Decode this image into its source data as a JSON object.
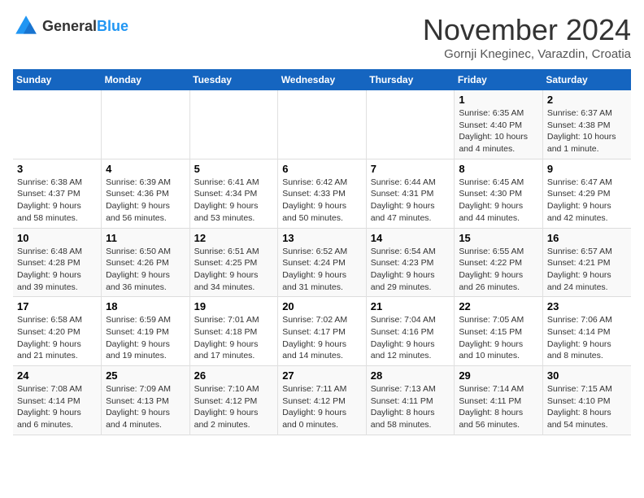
{
  "header": {
    "logo_general": "General",
    "logo_blue": "Blue",
    "month_year": "November 2024",
    "location": "Gornji Kneginec, Varazdin, Croatia"
  },
  "days_of_week": [
    "Sunday",
    "Monday",
    "Tuesday",
    "Wednesday",
    "Thursday",
    "Friday",
    "Saturday"
  ],
  "weeks": [
    [
      {
        "day": "",
        "info": ""
      },
      {
        "day": "",
        "info": ""
      },
      {
        "day": "",
        "info": ""
      },
      {
        "day": "",
        "info": ""
      },
      {
        "day": "",
        "info": ""
      },
      {
        "day": "1",
        "info": "Sunrise: 6:35 AM\nSunset: 4:40 PM\nDaylight: 10 hours and 4 minutes."
      },
      {
        "day": "2",
        "info": "Sunrise: 6:37 AM\nSunset: 4:38 PM\nDaylight: 10 hours and 1 minute."
      }
    ],
    [
      {
        "day": "3",
        "info": "Sunrise: 6:38 AM\nSunset: 4:37 PM\nDaylight: 9 hours and 58 minutes."
      },
      {
        "day": "4",
        "info": "Sunrise: 6:39 AM\nSunset: 4:36 PM\nDaylight: 9 hours and 56 minutes."
      },
      {
        "day": "5",
        "info": "Sunrise: 6:41 AM\nSunset: 4:34 PM\nDaylight: 9 hours and 53 minutes."
      },
      {
        "day": "6",
        "info": "Sunrise: 6:42 AM\nSunset: 4:33 PM\nDaylight: 9 hours and 50 minutes."
      },
      {
        "day": "7",
        "info": "Sunrise: 6:44 AM\nSunset: 4:31 PM\nDaylight: 9 hours and 47 minutes."
      },
      {
        "day": "8",
        "info": "Sunrise: 6:45 AM\nSunset: 4:30 PM\nDaylight: 9 hours and 44 minutes."
      },
      {
        "day": "9",
        "info": "Sunrise: 6:47 AM\nSunset: 4:29 PM\nDaylight: 9 hours and 42 minutes."
      }
    ],
    [
      {
        "day": "10",
        "info": "Sunrise: 6:48 AM\nSunset: 4:28 PM\nDaylight: 9 hours and 39 minutes."
      },
      {
        "day": "11",
        "info": "Sunrise: 6:50 AM\nSunset: 4:26 PM\nDaylight: 9 hours and 36 minutes."
      },
      {
        "day": "12",
        "info": "Sunrise: 6:51 AM\nSunset: 4:25 PM\nDaylight: 9 hours and 34 minutes."
      },
      {
        "day": "13",
        "info": "Sunrise: 6:52 AM\nSunset: 4:24 PM\nDaylight: 9 hours and 31 minutes."
      },
      {
        "day": "14",
        "info": "Sunrise: 6:54 AM\nSunset: 4:23 PM\nDaylight: 9 hours and 29 minutes."
      },
      {
        "day": "15",
        "info": "Sunrise: 6:55 AM\nSunset: 4:22 PM\nDaylight: 9 hours and 26 minutes."
      },
      {
        "day": "16",
        "info": "Sunrise: 6:57 AM\nSunset: 4:21 PM\nDaylight: 9 hours and 24 minutes."
      }
    ],
    [
      {
        "day": "17",
        "info": "Sunrise: 6:58 AM\nSunset: 4:20 PM\nDaylight: 9 hours and 21 minutes."
      },
      {
        "day": "18",
        "info": "Sunrise: 6:59 AM\nSunset: 4:19 PM\nDaylight: 9 hours and 19 minutes."
      },
      {
        "day": "19",
        "info": "Sunrise: 7:01 AM\nSunset: 4:18 PM\nDaylight: 9 hours and 17 minutes."
      },
      {
        "day": "20",
        "info": "Sunrise: 7:02 AM\nSunset: 4:17 PM\nDaylight: 9 hours and 14 minutes."
      },
      {
        "day": "21",
        "info": "Sunrise: 7:04 AM\nSunset: 4:16 PM\nDaylight: 9 hours and 12 minutes."
      },
      {
        "day": "22",
        "info": "Sunrise: 7:05 AM\nSunset: 4:15 PM\nDaylight: 9 hours and 10 minutes."
      },
      {
        "day": "23",
        "info": "Sunrise: 7:06 AM\nSunset: 4:14 PM\nDaylight: 9 hours and 8 minutes."
      }
    ],
    [
      {
        "day": "24",
        "info": "Sunrise: 7:08 AM\nSunset: 4:14 PM\nDaylight: 9 hours and 6 minutes."
      },
      {
        "day": "25",
        "info": "Sunrise: 7:09 AM\nSunset: 4:13 PM\nDaylight: 9 hours and 4 minutes."
      },
      {
        "day": "26",
        "info": "Sunrise: 7:10 AM\nSunset: 4:12 PM\nDaylight: 9 hours and 2 minutes."
      },
      {
        "day": "27",
        "info": "Sunrise: 7:11 AM\nSunset: 4:12 PM\nDaylight: 9 hours and 0 minutes."
      },
      {
        "day": "28",
        "info": "Sunrise: 7:13 AM\nSunset: 4:11 PM\nDaylight: 8 hours and 58 minutes."
      },
      {
        "day": "29",
        "info": "Sunrise: 7:14 AM\nSunset: 4:11 PM\nDaylight: 8 hours and 56 minutes."
      },
      {
        "day": "30",
        "info": "Sunrise: 7:15 AM\nSunset: 4:10 PM\nDaylight: 8 hours and 54 minutes."
      }
    ]
  ]
}
